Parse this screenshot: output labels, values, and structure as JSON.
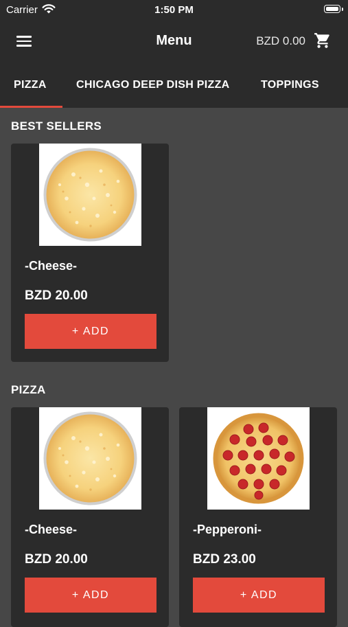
{
  "status_bar": {
    "carrier": "Carrier",
    "time": "1:50 PM"
  },
  "header": {
    "title": "Menu",
    "balance": "BZD 0.00"
  },
  "tabs": [
    {
      "label": "PIZZA",
      "active": true
    },
    {
      "label": "CHICAGO DEEP DISH PIZZA",
      "active": false
    },
    {
      "label": "TOPPINGS",
      "active": false
    }
  ],
  "sections": [
    {
      "title": "BEST SELLERS",
      "items": [
        {
          "name": "-Cheese-",
          "price": "BZD 20.00",
          "button": "+ ADD",
          "image": "cheese-pizza"
        }
      ]
    },
    {
      "title": "PIZZA",
      "items": [
        {
          "name": "-Cheese-",
          "price": "BZD 20.00",
          "button": "+ ADD",
          "image": "cheese-pizza"
        },
        {
          "name": "-Pepperoni-",
          "price": "BZD 23.00",
          "button": "+ ADD",
          "image": "pepperoni-pizza"
        }
      ]
    }
  ],
  "colors": {
    "accent": "#e34a3c",
    "header_bg": "#2b2b2b",
    "page_bg": "#474747",
    "card_bg": "#2b2b2b"
  },
  "icons": {
    "menu": "hamburger-icon",
    "cart": "cart-icon",
    "wifi": "wifi-icon",
    "battery": "battery-icon"
  }
}
